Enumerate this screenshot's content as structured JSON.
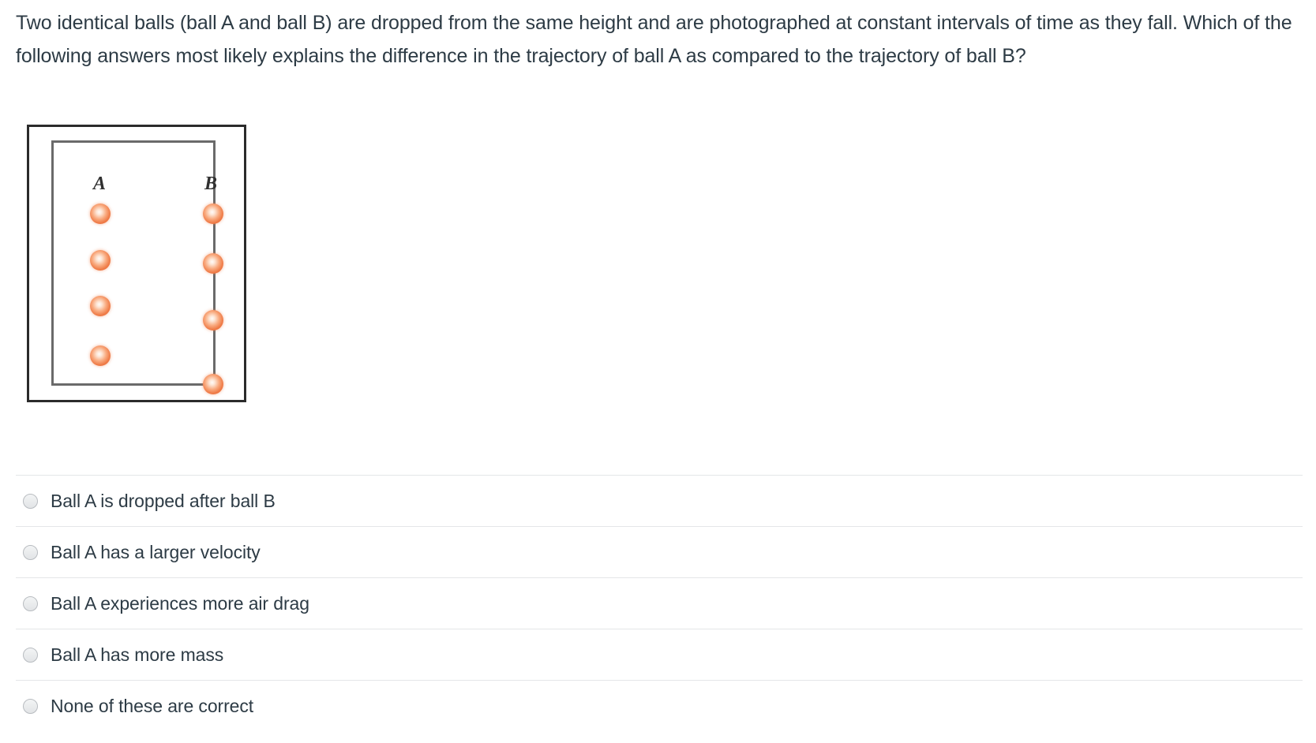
{
  "question": {
    "text": "Two identical balls (ball A and ball B) are dropped from the same height and are photographed at constant intervals of time as they fall. Which of the following answers most likely explains the difference in the trajectory of ball A as compared to the trajectory of ball B?"
  },
  "figure": {
    "alt": "Two columns of falling balls photographed at constant time intervals",
    "column_labels": {
      "a": "A",
      "b": "B"
    },
    "ball_color_center": "#fffbf8",
    "ball_color_edge": "#e36732",
    "outer_frame_color": "#2b2b2b",
    "inner_frame_color": "#6a6a6a",
    "columns": [
      {
        "label": "A",
        "x": 59,
        "ball_y": [
          90,
          149,
          207,
          270
        ],
        "spacing": "constant"
      },
      {
        "label": "B",
        "x": 202,
        "ball_y": [
          90,
          153,
          225,
          306
        ],
        "spacing": "increasing"
      }
    ]
  },
  "answers": {
    "options": [
      {
        "id": "opt-1",
        "label": "Ball A is dropped after ball B",
        "selected": false
      },
      {
        "id": "opt-2",
        "label": "Ball A has a larger velocity",
        "selected": false
      },
      {
        "id": "opt-3",
        "label": "Ball A experiences more air drag",
        "selected": false
      },
      {
        "id": "opt-4",
        "label": "Ball A has more mass",
        "selected": false
      },
      {
        "id": "opt-5",
        "label": "None of these are correct",
        "selected": false
      }
    ]
  },
  "chart_data": {
    "type": "scatter",
    "title": "Positions of falling balls A and B at constant time intervals",
    "xlabel": "",
    "ylabel": "",
    "series": [
      {
        "name": "A",
        "x": [
          59,
          59,
          59,
          59
        ],
        "y": [
          90,
          149,
          207,
          270
        ]
      },
      {
        "name": "B",
        "x": [
          202,
          202,
          202,
          202
        ],
        "y": [
          90,
          153,
          225,
          306
        ]
      }
    ]
  }
}
